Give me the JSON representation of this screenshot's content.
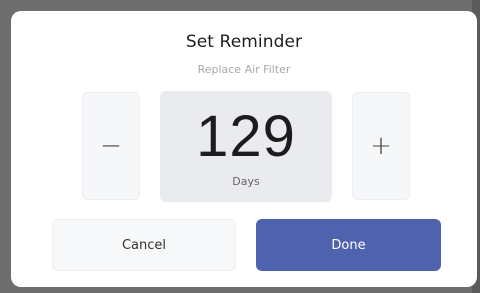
{
  "dialog": {
    "title": "Set Reminder",
    "subtitle": "Replace Air Filter"
  },
  "stepper": {
    "decrement_label": "−",
    "increment_label": "+",
    "value": "129",
    "unit": "Days"
  },
  "actions": {
    "cancel_label": "Cancel",
    "done_label": "Done"
  },
  "colors": {
    "accent": "#4f62ad",
    "value_box": "#e9ebef",
    "backdrop": "#6d6d6d"
  }
}
